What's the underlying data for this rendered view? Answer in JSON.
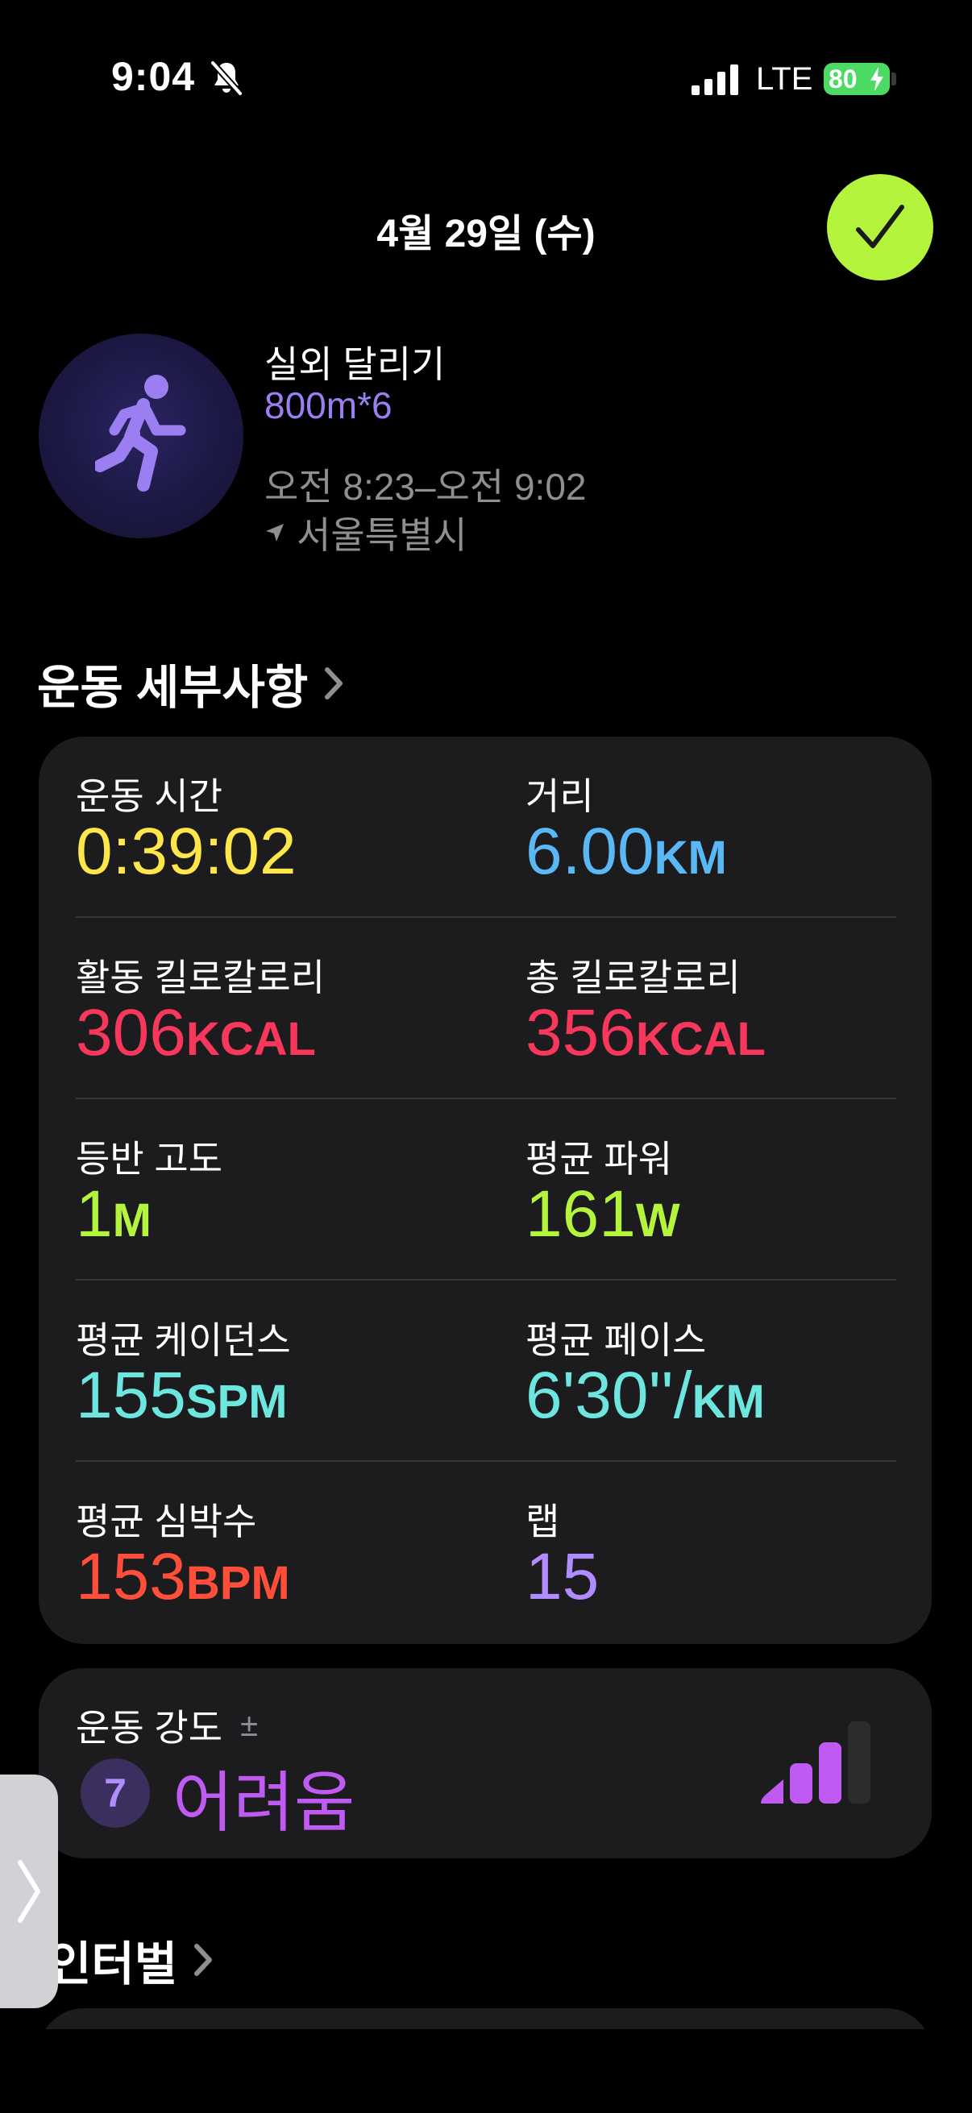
{
  "status_bar": {
    "time": "9:04",
    "network": "LTE",
    "battery": "80",
    "icons": [
      "bell-slash-icon",
      "signal-icon",
      "battery-charging-icon"
    ],
    "battery_color": "#4cd964"
  },
  "header": {
    "date": "4월 29일 (수)",
    "done_icon": "checkmark-icon",
    "done_color": "#b4f43c"
  },
  "workout": {
    "icon": "runner-icon",
    "type": "실외 달리기",
    "name": "800m*6",
    "time_range": "오전 8:23–오전 9:02",
    "location": "서울특별시"
  },
  "details": {
    "title": "운동 세부사항",
    "metrics": [
      {
        "label": "운동 시간",
        "value": "0:39:02",
        "unit": "",
        "color": "#ffe74a"
      },
      {
        "label": "거리",
        "value": "6.00",
        "unit": "KM",
        "color": "#5ab8f5"
      },
      {
        "label": "활동 킬로칼로리",
        "value": "306",
        "unit": "KCAL",
        "color": "#f8375d"
      },
      {
        "label": "총 킬로칼로리",
        "value": "356",
        "unit": "KCAL",
        "color": "#f8375d"
      },
      {
        "label": "등반 고도",
        "value": "1",
        "unit": "M",
        "color": "#b4f43c"
      },
      {
        "label": "평균 파워",
        "value": "161",
        "unit": "W",
        "color": "#b4f43c"
      },
      {
        "label": "평균 케이던스",
        "value": "155",
        "unit": "SPM",
        "color": "#6ee6e0"
      },
      {
        "label": "평균 페이스",
        "value": "6'30''/",
        "unit": "KM",
        "color": "#6ee6e0"
      },
      {
        "label": "평균 심박수",
        "value": "153",
        "unit": "BPM",
        "color": "#ff4f3a"
      },
      {
        "label": "랩",
        "value": "15",
        "unit": "",
        "color": "#b08cff"
      }
    ]
  },
  "effort": {
    "label": "운동 강도",
    "adjust": "±",
    "score": "7",
    "level": "어려움",
    "level_color": "#bf5af2",
    "bars_filled": 3,
    "bars_total": 4
  },
  "intervals": {
    "title": "인터벌"
  },
  "side_handle": {
    "icon": "chevron-right-icon"
  }
}
